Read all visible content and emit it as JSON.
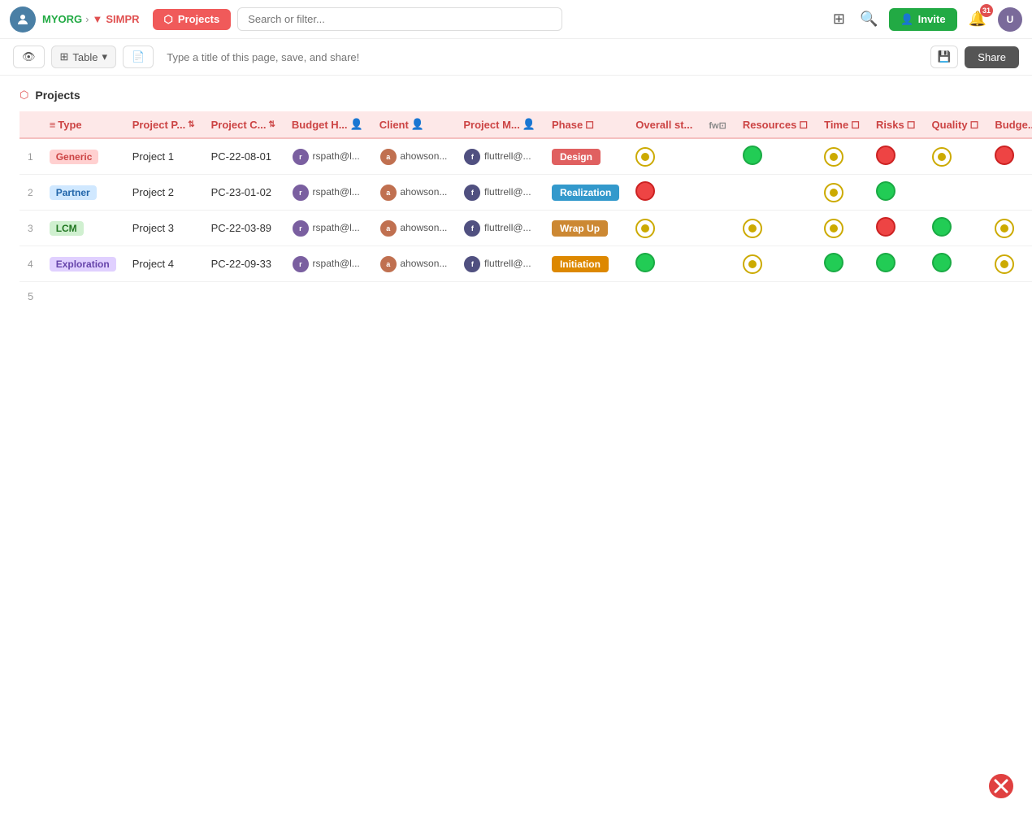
{
  "nav": {
    "org": "MYORG",
    "project": "SIMPR",
    "projects_label": "Projects",
    "search_placeholder": "Search or filter...",
    "invite_label": "Invite",
    "notif_count": "31"
  },
  "toolbar": {
    "table_label": "Table",
    "title_placeholder": "Type a title of this page, save, and share!",
    "share_label": "Share"
  },
  "page": {
    "title": "Projects"
  },
  "table": {
    "columns": [
      "Type",
      "Project P...",
      "Project C...",
      "Budget H...",
      "Client",
      "Project M...",
      "Phase",
      "Overall st...",
      "",
      "Resources",
      "Time",
      "Risks",
      "Quality",
      "Budge..."
    ],
    "rows": [
      {
        "num": "1",
        "type": "Generic",
        "type_class": "badge-generic",
        "project_name": "Project 1",
        "project_code": "PC-22-08-01",
        "budget_holder": "rspath@l...",
        "client": "ahowson...",
        "project_manager": "fluttrell@...",
        "phase": "Design",
        "phase_class": "phase-design",
        "overall_status": "yellow",
        "fw": "",
        "resources": "green",
        "time": "yellow",
        "risks": "red",
        "quality": "yellow",
        "budget": "red"
      },
      {
        "num": "2",
        "type": "Partner",
        "type_class": "badge-partner",
        "project_name": "Project 2",
        "project_code": "PC-23-01-02",
        "budget_holder": "rspath@l...",
        "client": "ahowson...",
        "project_manager": "fluttrell@...",
        "phase": "Realization",
        "phase_class": "phase-realization",
        "overall_status": "red",
        "fw": "",
        "resources": "",
        "time": "yellow",
        "risks": "green",
        "quality": "",
        "budget": ""
      },
      {
        "num": "3",
        "type": "LCM",
        "type_class": "badge-lcm",
        "project_name": "Project 3",
        "project_code": "PC-22-03-89",
        "budget_holder": "rspath@l...",
        "client": "ahowson...",
        "project_manager": "fluttrell@...",
        "phase": "Wrap Up",
        "phase_class": "phase-wrapup",
        "overall_status": "yellow",
        "fw": "",
        "resources": "yellow",
        "time": "yellow",
        "risks": "red",
        "quality": "green",
        "budget": "yellow"
      },
      {
        "num": "4",
        "type": "Exploration",
        "type_class": "badge-exploration",
        "project_name": "Project 4",
        "project_code": "PC-22-09-33",
        "budget_holder": "rspath@l...",
        "client": "ahowson...",
        "project_manager": "fluttrell@...",
        "phase": "Initiation",
        "phase_class": "phase-initiation",
        "overall_status": "green",
        "fw": "",
        "resources": "yellow",
        "time": "green",
        "risks": "green",
        "quality": "green",
        "budget": "yellow"
      }
    ]
  }
}
